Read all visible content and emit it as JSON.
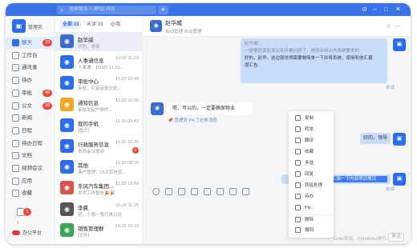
{
  "search": {
    "placeholder": "搜索联系人/群组/消息"
  },
  "brand": {
    "name": "管理员"
  },
  "nav": {
    "items": [
      {
        "label": "聊天",
        "badge": "33",
        "active": true
      },
      {
        "label": "工作台",
        "badge": "",
        "active": false
      },
      {
        "label": "通讯录",
        "badge": "",
        "active": false
      },
      {
        "label": "待办",
        "badge": "",
        "active": false
      },
      {
        "label": "审批",
        "badge": "48",
        "active": false
      },
      {
        "label": "公文",
        "badge": "33",
        "active": false
      },
      {
        "label": "新闻",
        "badge": "",
        "active": false
      },
      {
        "label": "日程",
        "badge": "",
        "active": false
      },
      {
        "label": "待办日程",
        "badge": "",
        "active": false
      },
      {
        "label": "文档",
        "badge": "",
        "active": false
      },
      {
        "label": "视频会议",
        "badge": "",
        "active": false
      },
      {
        "label": "应用",
        "badge": "",
        "active": false
      },
      {
        "label": "收藏",
        "badge": "",
        "active": false
      }
    ],
    "bottom_badge": "1",
    "footer": "办公平台"
  },
  "list": {
    "tabs": [
      "全部 33",
      "未读 33",
      "@我"
    ],
    "rows": [
      {
        "name": "赵华威",
        "time": "",
        "preview": "好的，领导",
        "color": "#3b6bcf",
        "badge": "",
        "selected": true
      },
      {
        "name": "人事通信息",
        "time": "12-02 11:23",
        "preview": "人事通：【2025-12-01...",
        "color": "#2b6cf0",
        "badge": "",
        "selected": false
      },
      {
        "name": "审批中心",
        "time": "11-20 10:48",
        "preview": "审批：孔苗苗提交的...",
        "color": "#2b6cf0",
        "badge": "",
        "selected": false
      },
      {
        "name": "通知信息",
        "time": "11-20 10:35",
        "preview": "审批发起户侧的...",
        "color": "#f5a623",
        "badge": "",
        "selected": false
      },
      {
        "name": "我的手机",
        "time": "11-20 09:42",
        "preview": "[图片]",
        "color": "#2b6cf0",
        "badge": "",
        "selected": false
      },
      {
        "name": "行政服务信息",
        "time": "11-20 10:25",
        "preview": "视频会议邀请",
        "color": "#2b6cf0",
        "badge": "2",
        "selected": false
      },
      {
        "name": "其他",
        "time": "11-20 08:30",
        "preview": "客户管理：15天后信息...",
        "color": "#2b6cf0",
        "badge": "",
        "selected": false
      },
      {
        "name": "东风汽车集团...",
        "time": "11-20 13:59",
        "preview": "本次工作暂告🎉🎉",
        "color": "#d9534f",
        "badge": "",
        "selected": false
      },
      {
        "name": "李晨",
        "time": "10-20 11:25",
        "preview": "好，下周一我们再讨论",
        "color": "#555",
        "badge": "",
        "selected": false
      },
      {
        "name": "销售管理群",
        "time": "10-20 10:22",
        "preview": "[文件]",
        "color": "#3aa757",
        "badge": "",
        "selected": false
      }
    ]
  },
  "chat": {
    "name": "赵华威",
    "subtitle": "自动管理  自动管理",
    "messages": {
      "quote_lines": [
        "赵华威：",
        "一是要把该应满足条件要问题了，再就业网点的系统要求的"
      ],
      "right_lines": [
        "好的，赵华，这边我觉得需要做简单一下并将系统，使用和信汇报",
        "度汇告"
      ],
      "unread": "未读",
      "left_text": "嗯，可以的，一定要确保物业",
      "pin_text": "管理员 Pin了这条消息",
      "ok_text": "好的，领导",
      "highlight_text": "部门汇报信息汇报一下内部项目情况"
    },
    "footer_hint": "Enter发送，Ctrl+Enter换行",
    "send_label": "发送"
  },
  "context_menu": {
    "items": [
      "复制",
      "转发",
      "翻译",
      "收藏",
      "多选",
      "回复",
      "转给处理",
      "待办",
      "Pin",
      "删除",
      "撤回"
    ]
  }
}
